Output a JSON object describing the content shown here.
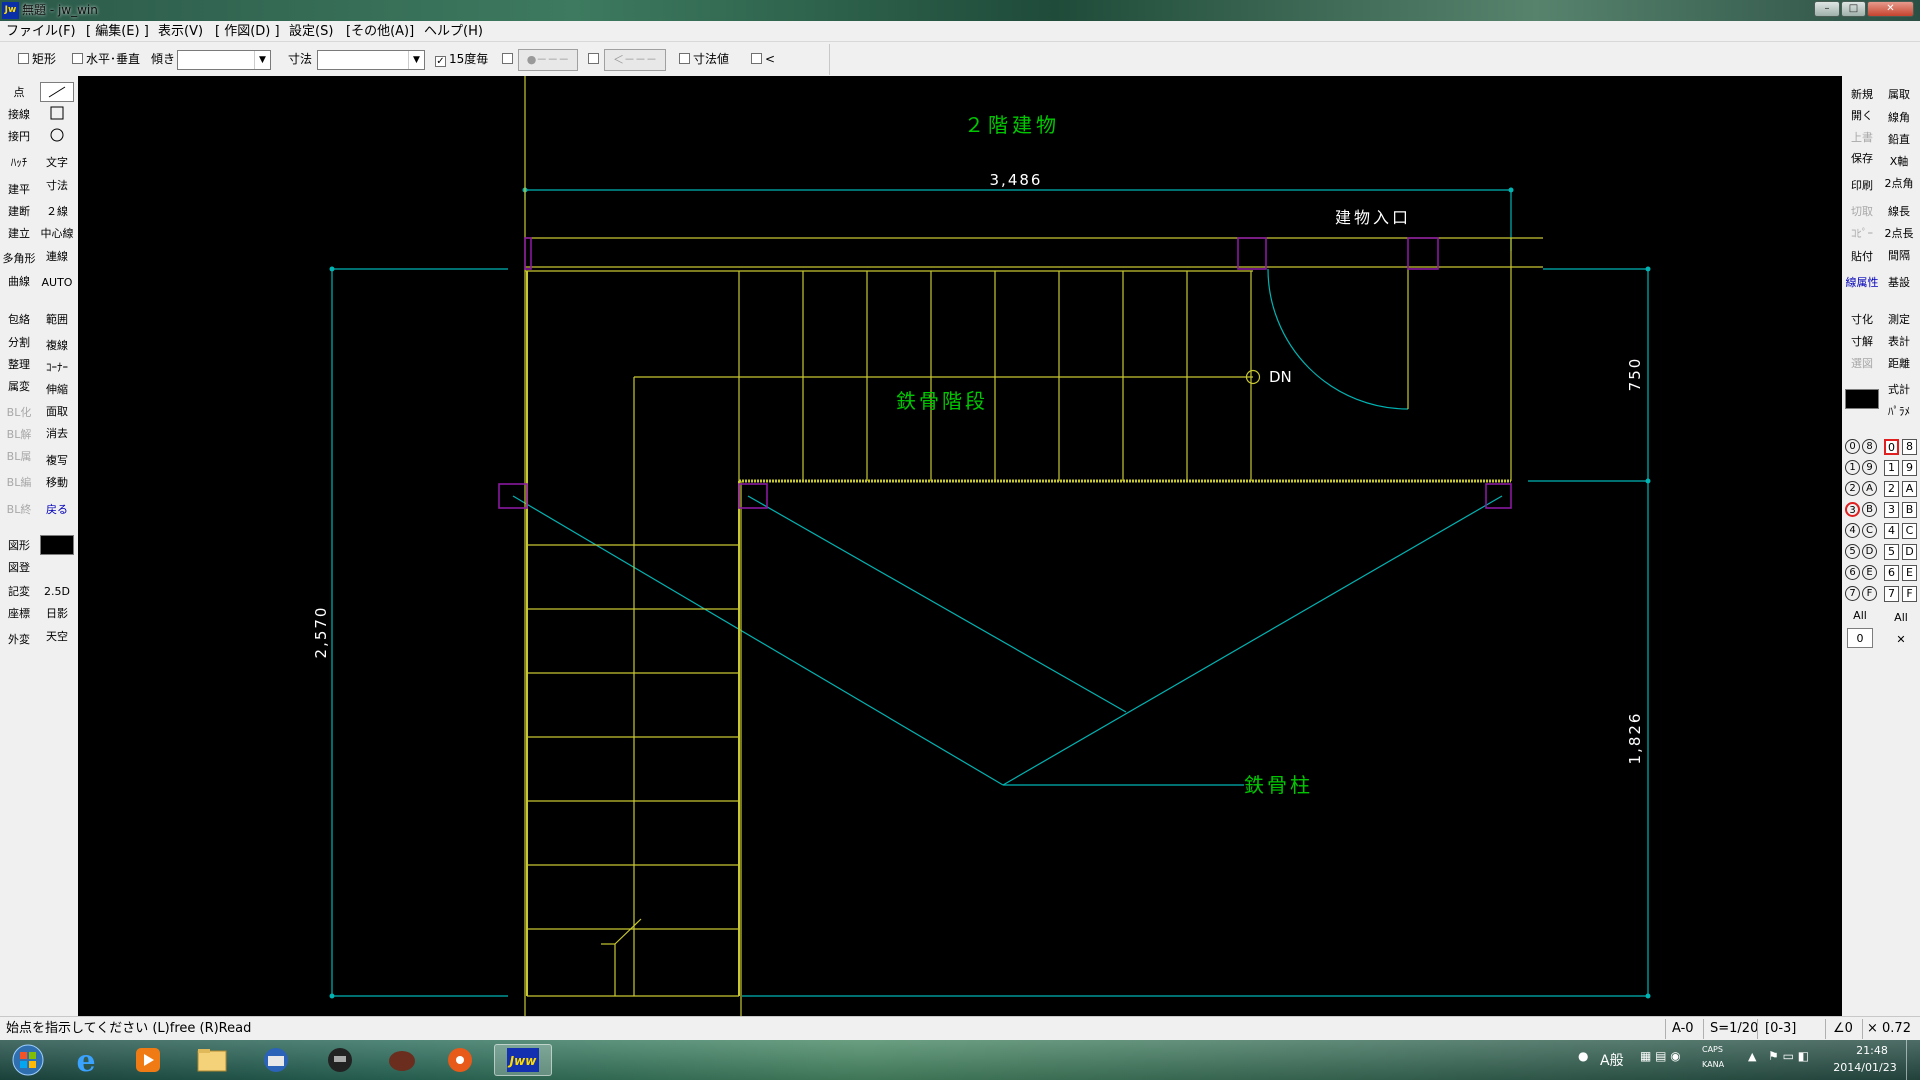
{
  "window": {
    "title": "無題 - jw_win",
    "app_icon": "Jw",
    "min": "–",
    "max": "□",
    "close": "✕"
  },
  "menu": [
    "ファイル(F)",
    "[ 編集(E) ]",
    "表示(V)",
    "[ 作図(D) ]",
    "設定(S)",
    "[その他(A)]",
    "ヘルプ(H)"
  ],
  "toolbar": {
    "rect": "矩形",
    "horiz_vert": "水平･垂直",
    "tilt": "傾き",
    "dim": "寸法",
    "deg15": "15度毎",
    "dimval": "寸法値",
    "lt": "<",
    "dot_box": "●－－－",
    "arrow_box": "＜－－－"
  },
  "left_tools_col1": [
    "点",
    "接線",
    "接円",
    "ﾊｯﾁ",
    "建平",
    "建断",
    "建立",
    "多角形",
    "曲線",
    "包絡",
    "分割",
    "整理",
    "属変",
    "BL化",
    "BL解",
    "BL属",
    "BL編",
    "BL終",
    "図形",
    "図登",
    "記変",
    "座標",
    "外変"
  ],
  "left_tools_col2": [
    "文字",
    "寸法",
    "２線",
    "中心線",
    "連線",
    "AUTO",
    "範囲",
    "複線",
    "ｺｰﾅｰ",
    "伸縮",
    "面取",
    "消去",
    "複写",
    "移動",
    "戻る",
    "2.5D",
    "日影",
    "天空"
  ],
  "right_tools_col1": [
    "新規",
    "開く",
    "上書",
    "保存",
    "印刷",
    "切取",
    "ｺﾋﾟｰ",
    "貼付",
    "線属性",
    "寸化",
    "寸解",
    "選図",
    "式計"
  ],
  "right_tools_col2": [
    "属取",
    "線角",
    "鉛直",
    "X軸",
    "2点角",
    "線長",
    "2点長",
    "間隔",
    "基設",
    "測定",
    "表計",
    "距離",
    "式計",
    "ﾊﾟﾗﾒ"
  ],
  "layer_groups": [
    "0",
    "1",
    "2",
    "3",
    "4",
    "5",
    "6",
    "7",
    "8",
    "9",
    "A",
    "B",
    "C",
    "D",
    "E",
    "F"
  ],
  "layer_all": "All",
  "layer_zero": "0",
  "drawing": {
    "title": "２階建物",
    "dim_top": "3,486",
    "dim_left": "2,570",
    "dim_right_top": "750",
    "dim_right_bottom": "1,826",
    "entrance": "建物入口",
    "stairs": "鉄骨階段",
    "column": "鉄骨柱",
    "dn": "DN"
  },
  "status": {
    "prompt": "始点を指示してください (L)free (R)Read",
    "layer": "A-0",
    "scale": "S=1/20",
    "group": "[0-3]",
    "angle": "∠0",
    "zoom": "× 0.72"
  },
  "tray": {
    "time": "21:48",
    "date": "2014/01/23",
    "ime": "A般",
    "caps": "CAPS",
    "kana": "KANA"
  },
  "colors": {
    "canvas": "#000000",
    "dim_line": "#00b4b4",
    "object": "#c8c832",
    "label_green": "#00c800",
    "block": "#800080"
  }
}
